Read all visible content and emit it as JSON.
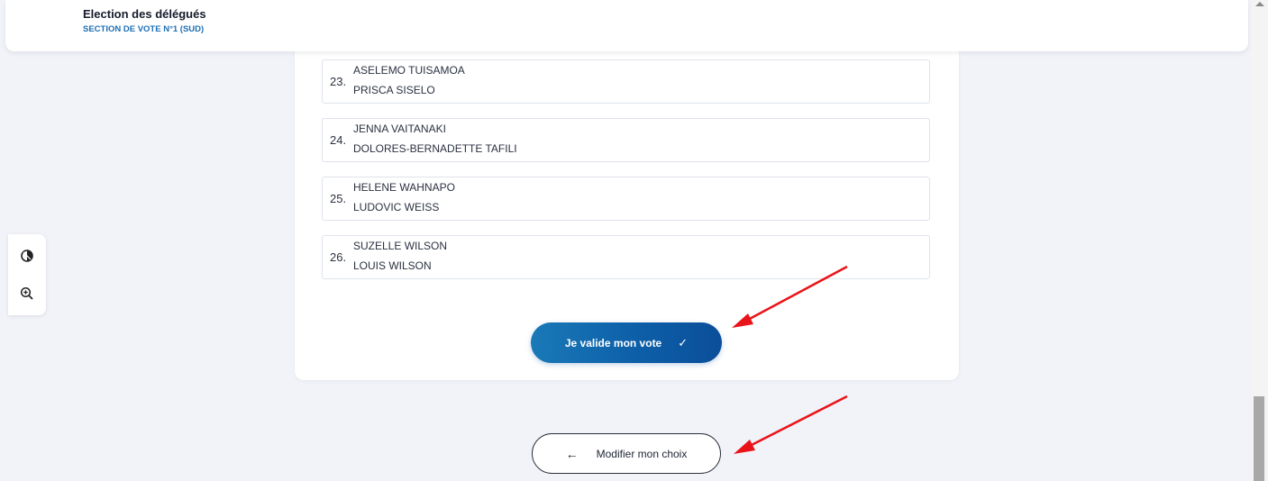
{
  "header": {
    "title": "Election des délégués",
    "subtitle": "SECTION DE VOTE N°1 (SUD)"
  },
  "candidates": [
    {
      "number": "23.",
      "name1": "ASELEMO TUISAMOA",
      "name2": "PRISCA SISELO"
    },
    {
      "number": "24.",
      "name1": "JENNA VAITANAKI",
      "name2": "DOLORES-BERNADETTE TAFILI"
    },
    {
      "number": "25.",
      "name1": "HELENE WAHNAPO",
      "name2": "LUDOVIC WEISS"
    },
    {
      "number": "26.",
      "name1": "SUZELLE WILSON",
      "name2": "LOUIS WILSON"
    }
  ],
  "buttons": {
    "validate_label": "Je valide mon vote",
    "modify_label": "Modifier mon choix"
  },
  "icons": {
    "validate": "check-icon",
    "modify": "arrow-left-icon",
    "contrast": "contrast-icon",
    "zoom": "zoom-in-icon"
  },
  "colors": {
    "accent": "#0d5fa8",
    "subtitle": "#1d6fb5",
    "annotation": "#e8141a"
  }
}
